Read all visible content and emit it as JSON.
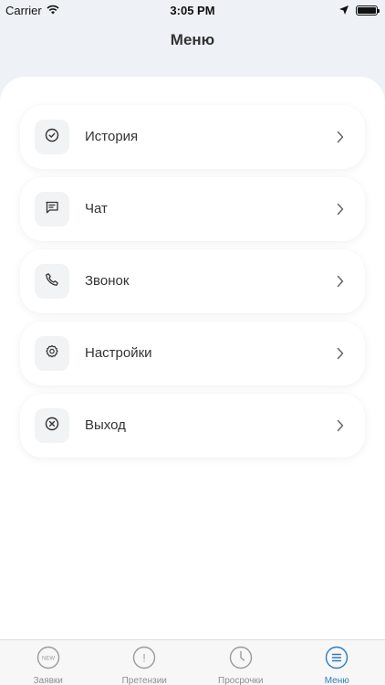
{
  "status_bar": {
    "carrier": "Carrier",
    "time": "3:05 PM"
  },
  "header": {
    "title": "Меню"
  },
  "menu": {
    "items": [
      {
        "label": "История",
        "icon": "check-circle-icon"
      },
      {
        "label": "Чат",
        "icon": "chat-icon"
      },
      {
        "label": "Звонок",
        "icon": "phone-icon"
      },
      {
        "label": "Настройки",
        "icon": "gear-icon"
      },
      {
        "label": "Выход",
        "icon": "close-circle-icon"
      }
    ]
  },
  "tab_bar": {
    "tabs": [
      {
        "label": "Заявки",
        "icon_text": "NEW",
        "icon": "new-badge-icon",
        "active": false
      },
      {
        "label": "Претензии",
        "icon_text": "!",
        "icon": "exclamation-icon",
        "active": false
      },
      {
        "label": "Просрочки",
        "icon": "clock-icon",
        "active": false
      },
      {
        "label": "Меню",
        "icon": "menu-lines-icon",
        "active": true
      }
    ]
  },
  "colors": {
    "header_bg": "#eef2f6",
    "accent": "#2f7bbf",
    "inactive": "#8e8e93"
  }
}
